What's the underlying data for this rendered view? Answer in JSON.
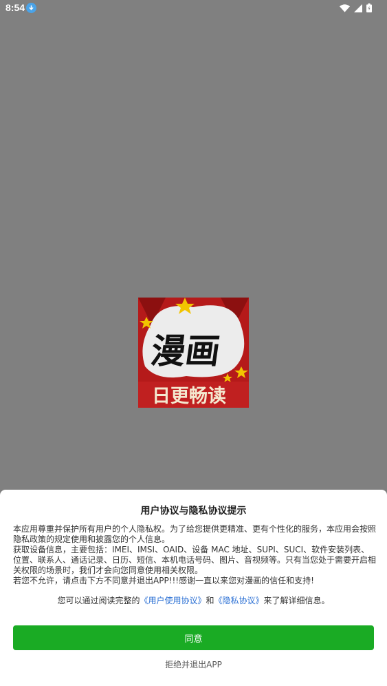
{
  "status_bar": {
    "time": "8:54"
  },
  "logo": {
    "title_text": "漫画",
    "subtitle_text": "日更畅读"
  },
  "dialog": {
    "title": "用户协议与隐私协议提示",
    "body_lines": [
      "本应用尊重并保护所有用户的个人隐私权。为了给您提供更精准、更有个性化的服务，本应用会按照隐私政策的规定使用和披露您的个人信息。",
      "获取设备信息，主要包括：IMEI、IMSI、OAID、设备 MAC 地址、SUPI、SUCI、软件安装列表、位置、联系人、通话记录、日历、短信、本机电话号码、图片、音视频等。只有当您处于需要开启相关权限的场景时，我们才会向您同意使用相关权限。",
      "若您不允许，请点击下方不同意并退出APP!!!感谢一直以来您对漫画的信任和支持!"
    ],
    "note_prefix": "您可以通过阅读完整的",
    "user_agreement_link": "《用户使用协议》",
    "note_and": "和",
    "privacy_link": "《隐私协议》",
    "note_suffix": "来了解详细信息。",
    "agree_label": "同意",
    "reject_label": "拒绝并退出APP"
  },
  "colors": {
    "accent": "#1aab24",
    "link": "#2a6fd4",
    "logo_red": "#b51a1a"
  }
}
